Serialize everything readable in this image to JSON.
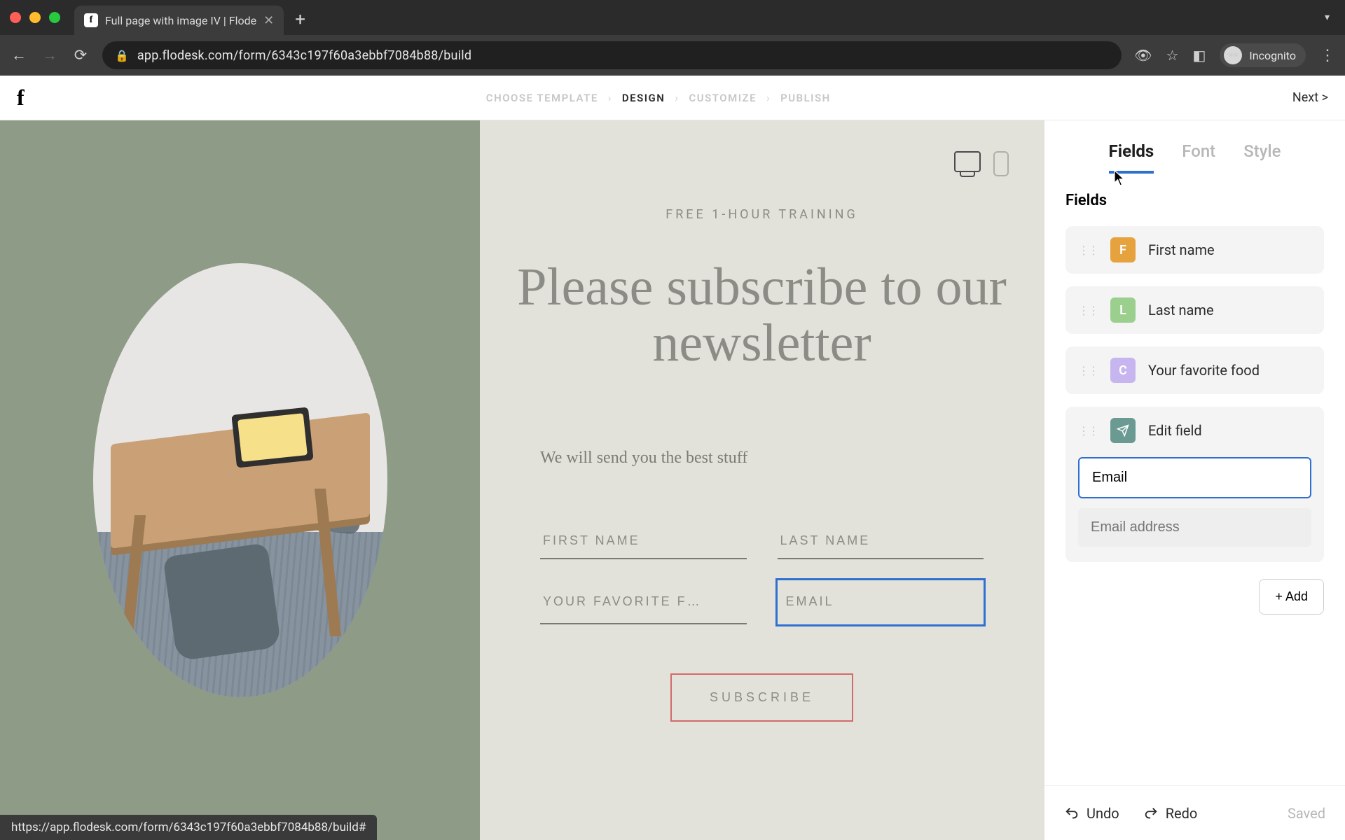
{
  "browser": {
    "tab_title": "Full page with image IV | Flode",
    "url": "app.flodesk.com/form/6343c197f60a3ebbf7084b88/build",
    "incognito_label": "Incognito",
    "status_url": "https://app.flodesk.com/form/6343c197f60a3ebbf7084b88/build#"
  },
  "header": {
    "steps": [
      "CHOOSE TEMPLATE",
      "DESIGN",
      "CUSTOMIZE",
      "PUBLISH"
    ],
    "active_step_index": 1,
    "next_label": "Next  >"
  },
  "canvas": {
    "eyebrow": "FREE 1-HOUR TRAINING",
    "headline": "Please subscribe to our newsletter",
    "subhead": "We will send you the best stuff",
    "fields": {
      "first_name_placeholder": "FIRST NAME",
      "last_name_placeholder": "LAST NAME",
      "fav_food_placeholder": "YOUR FAVORITE F…",
      "email_placeholder": "EMAIL"
    },
    "subscribe_label": "SUBSCRIBE"
  },
  "sidebar": {
    "tabs": {
      "fields": "Fields",
      "font": "Font",
      "style": "Style"
    },
    "active_tab": "fields",
    "panel_title": "Fields",
    "items": [
      {
        "badge_letter": "F",
        "badge_class": "b-orange",
        "label": "First name"
      },
      {
        "badge_letter": "L",
        "badge_class": "b-green",
        "label": "Last name"
      },
      {
        "badge_letter": "C",
        "badge_class": "b-purple",
        "label": "Your favorite food"
      }
    ],
    "edit": {
      "title": "Edit field",
      "input_value": "Email",
      "sub_placeholder": "Email address"
    },
    "add_label": "+ Add",
    "footer": {
      "undo": "Undo",
      "redo": "Redo",
      "saved": "Saved"
    }
  }
}
